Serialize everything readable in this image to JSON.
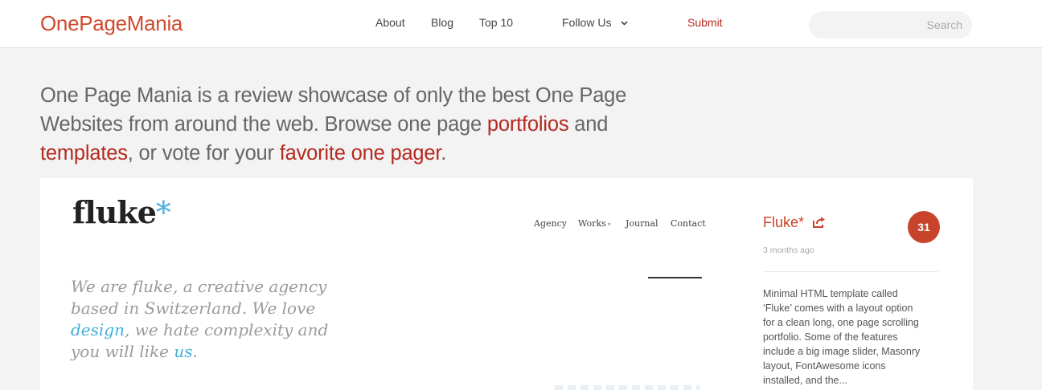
{
  "header": {
    "logo_part1": "One",
    "logo_part2": "PageMania",
    "nav": {
      "about": "About",
      "blog": "Blog",
      "top10": "Top 10",
      "follow": "Follow Us",
      "submit": "Submit"
    },
    "search_placeholder": "Search"
  },
  "intro": {
    "text1": "One Page Mania is a review showcase of only the best One Page Websites from around the web. Browse one page ",
    "link_portfolios": "portfolios",
    "text2": " and ",
    "link_templates": "templates",
    "text3": ", or vote for your ",
    "link_favorite": "favorite one pager",
    "text4": "."
  },
  "item": {
    "preview": {
      "logo": "fluke",
      "logo_star": "*",
      "nav": [
        "Agency",
        "Works",
        "Journal",
        "Contact"
      ],
      "nav_works_caret": "▾",
      "hero_1": "We are fluke, a creative agency based in Switzerland. We love ",
      "hero_hl1": "design",
      "hero_2": ", we hate complexity and you will like ",
      "hero_hl2": "us",
      "hero_3": "."
    },
    "title": "Fluke*",
    "date": "3 months ago",
    "votes": "31",
    "description": "Minimal HTML template called ‘Fluke’ comes with a layout option for a clean long, one page scrolling portfolio. Some of the features include a big image slider, Masonry layout, FontAwesome icons installed, and the..."
  },
  "colors": {
    "accent": "#c8432b",
    "link": "#b52a20",
    "page_bg": "#f3f3f3"
  },
  "icons": {
    "follow_caret": "chevron-down-icon",
    "share": "share-icon"
  }
}
